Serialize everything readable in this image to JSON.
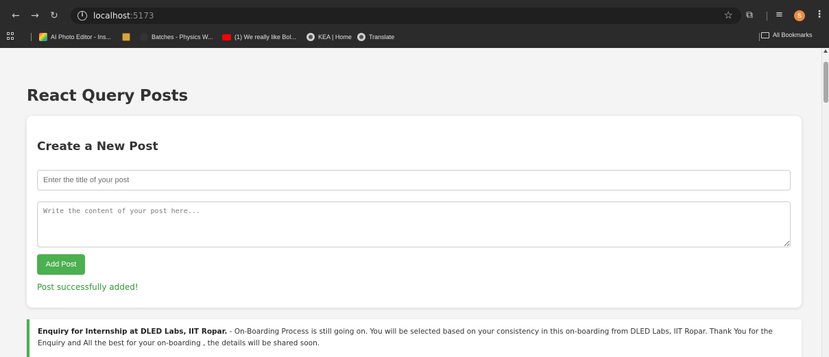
{
  "browser": {
    "url_host": "localhost",
    "url_port": ":5173",
    "bookmarks": [
      {
        "label": "AI Photo Editor - Ins...",
        "icon": "gradient-favicon"
      },
      {
        "label": "",
        "icon": "photo-favicon"
      },
      {
        "label": "Batches - Physics W...",
        "icon": "dark-favicon"
      },
      {
        "label": "(1) We really like Bol...",
        "icon": "youtube-favicon"
      },
      {
        "label": "KEA | Home",
        "icon": "globe-favicon"
      },
      {
        "label": "Translate",
        "icon": "globe-favicon"
      }
    ],
    "all_bookmarks_label": "All Bookmarks",
    "avatar_initial": "S"
  },
  "page": {
    "title": "React Query Posts"
  },
  "form": {
    "heading": "Create a New Post",
    "title_placeholder": "Enter the title of your post",
    "content_placeholder": "Write the content of your post here...",
    "submit_label": "Add Post",
    "status_message": "Post successfully added!",
    "colors": {
      "button": "#4caf50",
      "success": "#2e9a35"
    }
  },
  "posts": [
    {
      "title": "Enquiry for Internship at DLED Labs, IIT Ropar.",
      "separator": " - ",
      "body": "On-Boarding Process is still going on. You will be selected based on your consistency in this on-boarding from DLED Labs, IIT Ropar. Thank You for the Enquiry and All the best for your on-boarding , the details will be shared soon."
    }
  ]
}
